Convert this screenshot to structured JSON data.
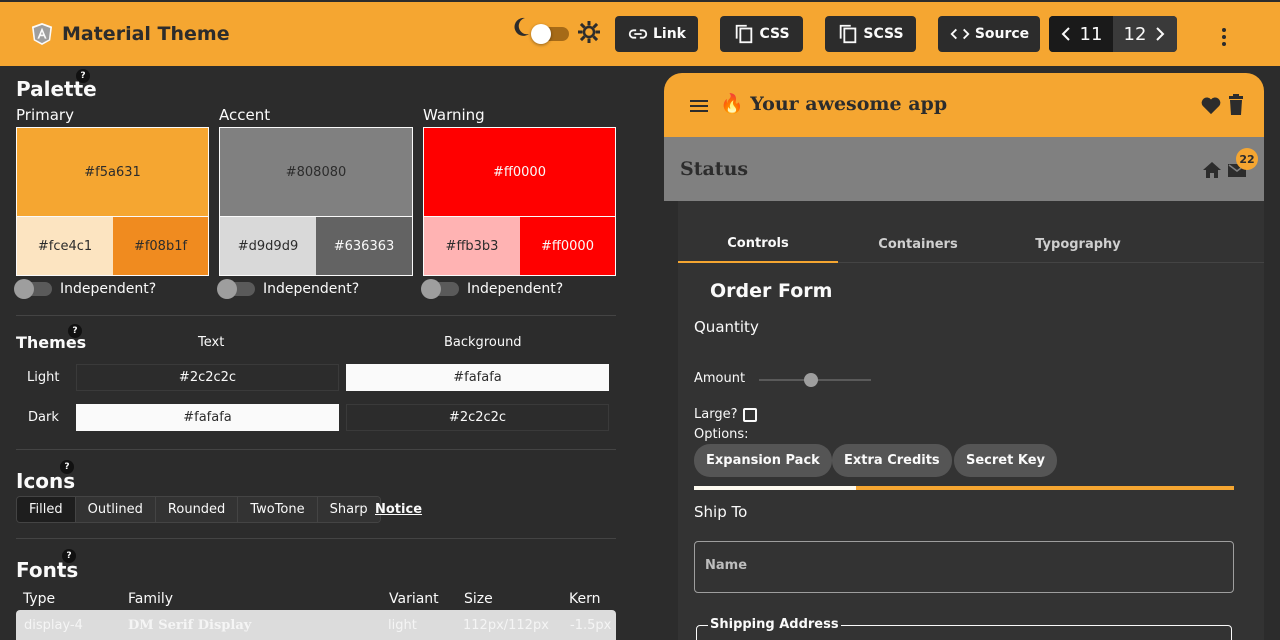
{
  "app": {
    "title": "Material Theme"
  },
  "toolbar": {
    "link_label": "Link",
    "css_label": "CSS",
    "scss_label": "SCSS",
    "source_label": "Source",
    "pager": {
      "current": "11",
      "next": "12"
    }
  },
  "palette": {
    "title": "Palette",
    "help": "?",
    "independent_label": "Independent?",
    "columns": [
      {
        "label": "Primary",
        "main": "#f5a631",
        "light": "#fce4c1",
        "dark": "#f08b1f"
      },
      {
        "label": "Accent",
        "main": "#808080",
        "light": "#d9d9d9",
        "dark": "#636363"
      },
      {
        "label": "Warning",
        "main": "#ff0000",
        "light": "#ffb3b3",
        "dark": "#ff0000"
      }
    ]
  },
  "themes": {
    "title": "Themes",
    "help": "?",
    "text_header": "Text",
    "background_header": "Background",
    "rows": [
      {
        "label": "Light",
        "text": "#2c2c2c",
        "background": "#fafafa"
      },
      {
        "label": "Dark",
        "text": "#fafafa",
        "background": "#2c2c2c"
      }
    ]
  },
  "icons": {
    "title": "Icons",
    "help": "?",
    "styles": [
      "Filled",
      "Outlined",
      "Rounded",
      "TwoTone",
      "Sharp"
    ],
    "selected": "Filled",
    "notice": "Notice"
  },
  "fonts": {
    "title": "Fonts",
    "help": "?",
    "headers": [
      "Type",
      "Family",
      "Variant",
      "Size",
      "Kern"
    ],
    "row": {
      "type": "display-4",
      "family": "DM Serif Display",
      "variant": "light",
      "size": "112px/112px",
      "kern": "-1.5px"
    }
  },
  "preview": {
    "app_title": "🔥 Your awesome app",
    "status_title": "Status",
    "badge": "22",
    "tabs": [
      "Controls",
      "Containers",
      "Typography"
    ],
    "active_tab": "Controls",
    "form": {
      "title": "Order Form",
      "quantity_label": "Quantity",
      "amount_label": "Amount",
      "amount_value": 0.46,
      "large_label": "Large?",
      "options_label": "Options:",
      "chips": [
        "Expansion Pack",
        "Extra Credits",
        "Secret Key"
      ],
      "progress": 0.3,
      "ship_to_label": "Ship To",
      "name_placeholder": "Name",
      "shipping_address_label": "Shipping Address"
    }
  },
  "colors": {
    "primary": "#f5a631",
    "dark_bg": "#2c2c2c",
    "light_text": "#fafafa"
  }
}
